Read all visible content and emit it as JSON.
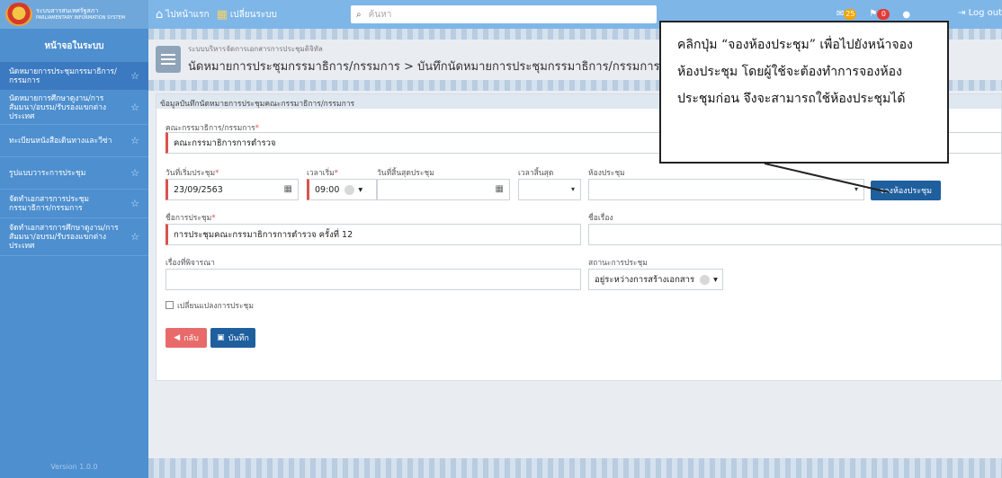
{
  "topbar": {
    "brand_line1": "ระบบสารสนเทศรัฐสภา",
    "brand_line2": "PARLIAMENTARY INFORMATION SYSTEM",
    "home_label": "ไปหน้าแรก",
    "switch_label": "เปลี่ยนระบบ",
    "search_placeholder": "ค้นหา",
    "badge_1": "25",
    "badge_2": "0",
    "logout_label": "Log out"
  },
  "sidebar": {
    "title": "หน้าจอในระบบ",
    "items": [
      {
        "label": "นัดหมายการประชุมกรรมาธิการ/กรรมการ"
      },
      {
        "label": "นัดหมายการศึกษาดูงาน/การสัมมนา/อบรม/รับรองแขกต่างประเทศ"
      },
      {
        "label": "ทะเบียนหนังสือเดินทางและวีซ่า"
      },
      {
        "label": "รูปแบบวาระการประชุม"
      },
      {
        "label": "จัดทำเอกสารการประชุมกรรมาธิการ/กรรมการ"
      },
      {
        "label": "จัดทำเอกสารการศึกษาดูงาน/การสัมมนา/อบรม/รับรองแขกต่างประเทศ"
      }
    ],
    "version": "Version 1.0.0"
  },
  "header": {
    "subtitle": "ระบบบริหารจัดการเอกสารการประชุมดิจิทัล",
    "title": "นัดหมายการประชุมกรรมาธิการ/กรรมการ > บันทึกนัดหมายการประชุมกรรมาธิการ/กรรมการ (DD"
  },
  "form": {
    "panel_title": "ข้อมูลบันทึกนัดหมายการประชุมคณะกรรมาธิการ/กรรมการ",
    "committee_label": "คณะกรรมาธิการ/กรรมการ",
    "committee_value": "คณะกรรมาธิการการตำรวจ",
    "start_date_label": "วันที่เริ่มประชุม",
    "start_date_value": "23/09/2563",
    "start_time_label": "เวลาเริ่ม",
    "start_time_value": "09:00",
    "end_date_label": "วันที่สิ้นสุดประชุม",
    "end_time_label": "เวลาสิ้นสุด",
    "room_label": "ห้องประชุม",
    "book_room_button": "จองห้องประชุม",
    "meeting_name_label": "ชื่อการประชุม",
    "meeting_name_value": "การประชุมคณะกรรมาธิการการตำรวจ ครั้งที่ 12",
    "subject_label": "ชื่อเรื่อง",
    "consider_label": "เรื่องที่พิจารณา",
    "status_label": "สถานะการประชุม",
    "status_value": "อยู่ระหว่างการสร้างเอกสาร",
    "change_checkbox_label": "เปลี่ยนแปลงการประชุม",
    "back_button": "กลับ",
    "save_button": "บันทึก",
    "required_mark": "*"
  },
  "callout": {
    "text": "คลิกปุ่ม “จองห้องประชุม” เพื่อไปยังหน้าจองห้องประชุม โดยผู้ใช้จะต้องทำการจองห้องประชุมก่อน จึงจะสามารถใช้ห้องประชุมได้"
  },
  "colors": {
    "topbar": "#7fb6e8",
    "sidebar": "#4d8fcf",
    "primary_button": "#1f5f9e",
    "back_button": "#e86a6a",
    "required": "#d9534f"
  }
}
